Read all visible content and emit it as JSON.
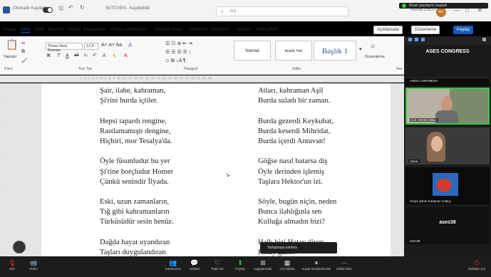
{
  "titlebar": {
    "autosave": "Otomatik Kaydet",
    "doc_title": "SUTÜVEN - Kaydedildi",
    "search_placeholder": "Ara",
    "user_name": "Ahmet USLU",
    "avatar_initials": "AU",
    "zoom_status": "Ekran paylaşımı başladı"
  },
  "menu": [
    "Dosya",
    "Giriş",
    "Ekle",
    "Tasarım",
    "Düzen",
    "Başvurular",
    "Posta Gönderileri",
    "Gözden Geçir",
    "Görünüm",
    "Geliştirici",
    "Yardım",
    "ACROBAT"
  ],
  "menu_active": "Giriş",
  "menu_right": {
    "comments": "Açıklamalar",
    "editing": "Düzenleme",
    "share": "Paylaş"
  },
  "ribbon": {
    "paste": "Yapıştır",
    "font_name": "Times New Roman",
    "font_size": "13,5",
    "style_normal": "Normal",
    "style_nospace": "Aralık Yok",
    "style_heading": "Başlık 1",
    "find": "Düzenleme",
    "groups": [
      "Pano",
      "Yazı Tipi",
      "Paragraf",
      "Stiller",
      "Ses"
    ]
  },
  "document": {
    "left_col": [
      "Şair, ilahe, kahraman,",
      "Şi'rini burda içtiler.",
      "",
      "Hepsi tapardı rengine,",
      "Rastlamamıştı dengine,",
      "Hiçbiri, mor Tesalya'da.",
      "",
      "Öyle füsunludur bu yer",
      "Şi'rine borçludur Homer",
      "Çünkü senindir İlyada.",
      "",
      "Eski, uzun zamanların,",
      "Tığ gibi kahramanların",
      "Türküsüdür sesin henüz.",
      "",
      "Dağda hayat uyandıran",
      "Taşları duygulandıran"
    ],
    "right_col": [
      "Atları, kahraman Aşil",
      "Burda suladı bir zaman.",
      "",
      "Burda gezerdi Keykubat,",
      "Burda keserdi Mihridat,",
      "Burda içerdi Antuvan!",
      "",
      "Göğse nasıl batarsa diş",
      "Öyle derinden işlemiş",
      "Taşlara Hektor'un izi.",
      "",
      "Söyle, bugün niçin, neden",
      "Bunca ilahlığınla sen",
      "Kulluğa almadın bizi?",
      "",
      "Halk bizi Hatay diyor",
      "Hatay güzel"
    ]
  },
  "zoom": {
    "panel_title": "ASES CONGRESS",
    "tiles": [
      {
        "name": "ASES CONGRESS"
      },
      {
        "name": "H.Z. Ahmet USLU"
      },
      {
        "name": "Aynur"
      },
      {
        "name": "Hülya Şahin Karaman (Haliç)"
      },
      {
        "name": "ases38"
      }
    ],
    "tile_big_label": "ases38",
    "tooltip": "Tartışmaya katılma",
    "bottom": [
      {
        "icon": "mic-icon",
        "label": "Ses"
      },
      {
        "icon": "video-icon",
        "label": "Video"
      },
      {
        "icon": "participants-icon",
        "label": "Katılımcılar",
        "count": "5"
      },
      {
        "icon": "chat-icon",
        "label": "Sohbet"
      },
      {
        "icon": "react-icon",
        "label": "Tepki ver"
      },
      {
        "icon": "share-icon",
        "label": "Paylaş"
      },
      {
        "icon": "apps-icon",
        "label": "Uygulamalar"
      },
      {
        "icon": "whiteboard-icon",
        "label": "Ara Odalar"
      },
      {
        "icon": "captions-icon",
        "label": "Kaydı Durdur/Durak"
      },
      {
        "icon": "more-icon",
        "label": "Daha fazla"
      }
    ],
    "leave": "Odadan Çık"
  },
  "colors": {
    "word_blue": "#185abd",
    "zoom_green": "#2ecc40",
    "leave_red": "#e02828"
  }
}
